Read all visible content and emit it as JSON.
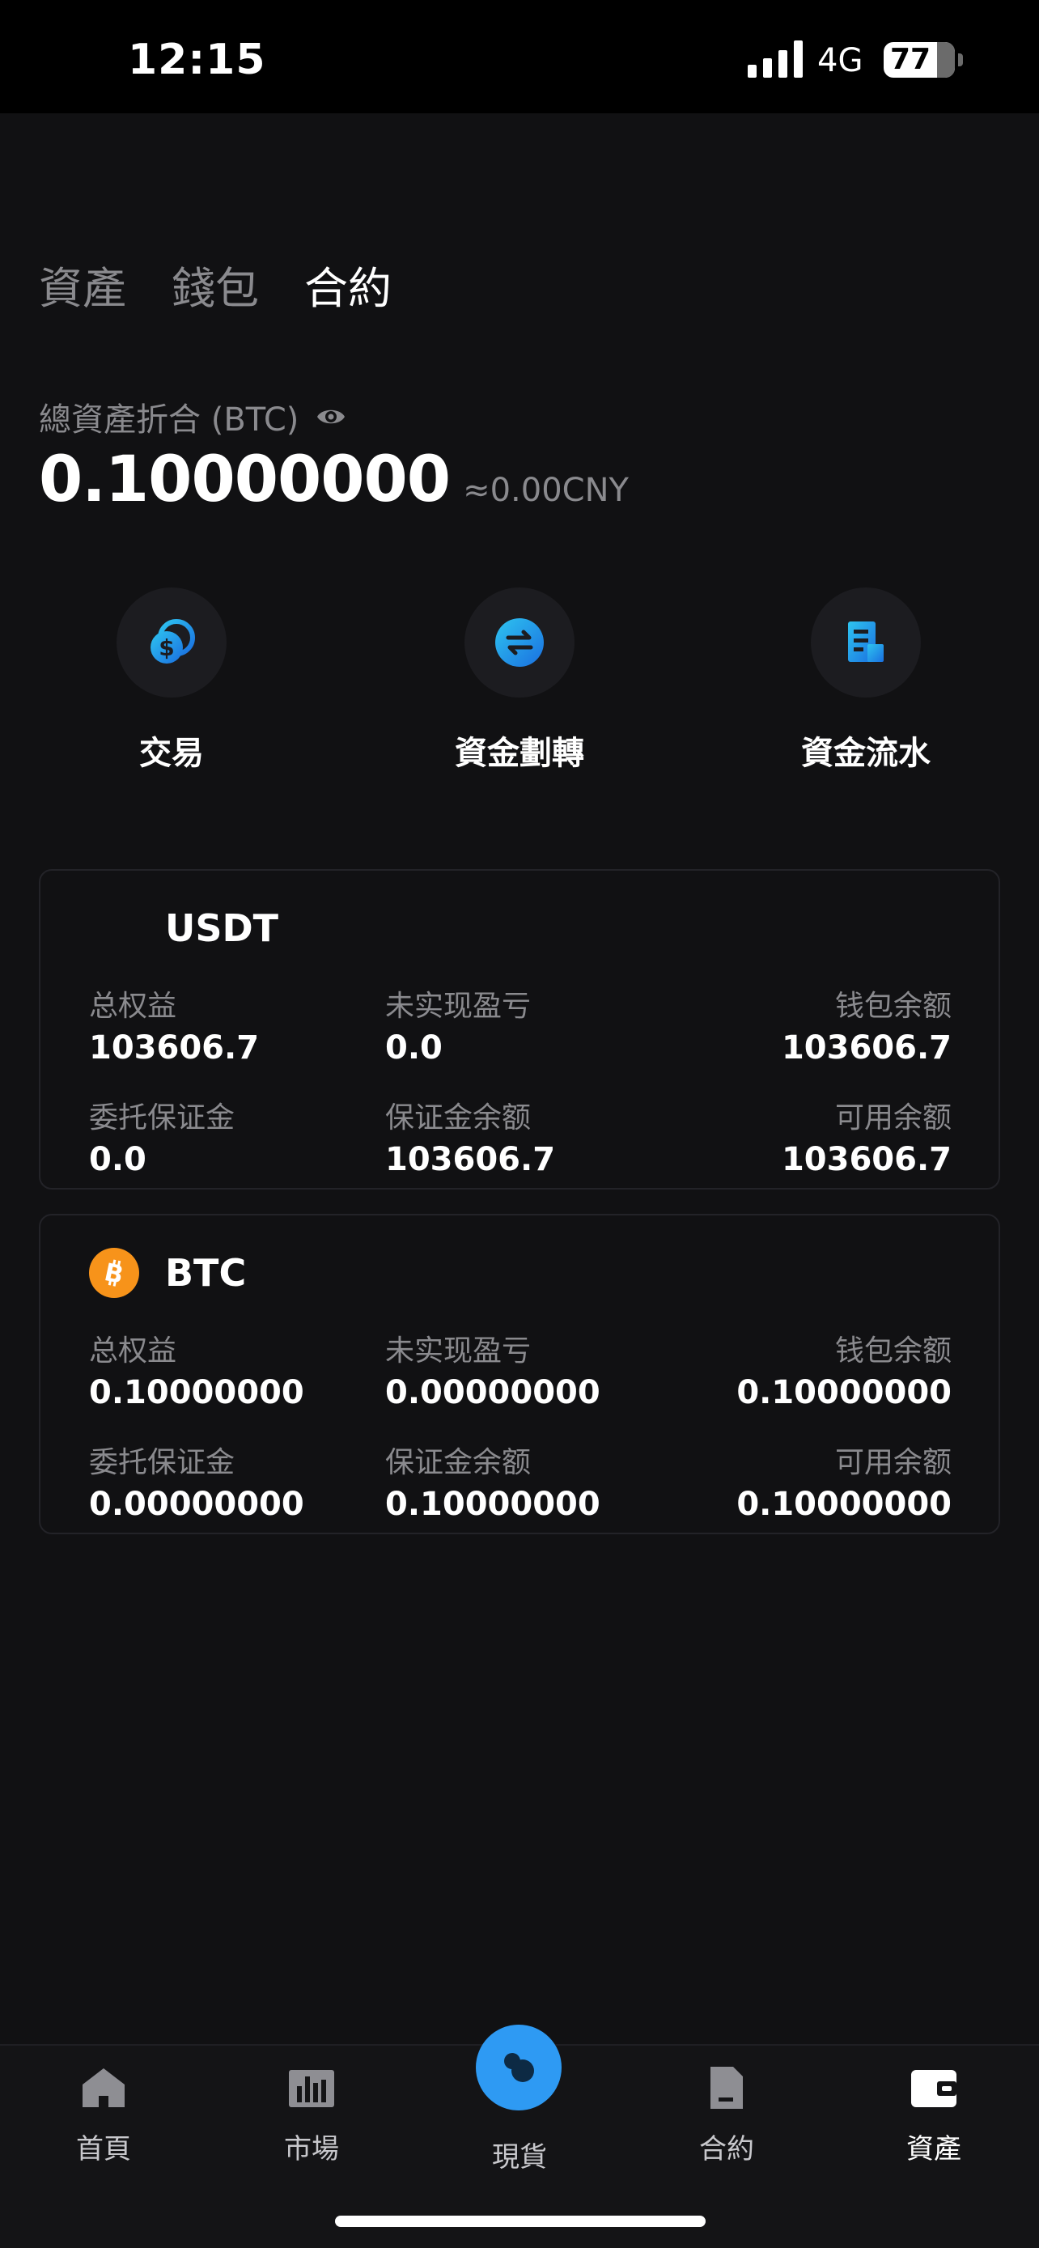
{
  "status_bar": {
    "time": "12:15",
    "network": "4G",
    "battery": "77"
  },
  "tabs": [
    {
      "label": "資產",
      "active": false
    },
    {
      "label": "錢包",
      "active": false
    },
    {
      "label": "合約",
      "active": true
    }
  ],
  "total": {
    "label": "總資產折合 (BTC)",
    "value": "0.10000000",
    "cny": "≈0.00CNY"
  },
  "actions": [
    {
      "label": "交易",
      "icon": "coin-swap-icon"
    },
    {
      "label": "資金劃轉",
      "icon": "transfer-icon"
    },
    {
      "label": "資金流水",
      "icon": "ledger-icon"
    }
  ],
  "accounts": [
    {
      "coin": "USDT",
      "icon": "",
      "total_equity_label": "总权益",
      "total_equity": "103606.7",
      "unrealized_pnl_label": "未实现盈亏",
      "unrealized_pnl": "0.0",
      "wallet_balance_label": "钱包余额",
      "wallet_balance": "103606.7",
      "order_margin_label": "委托保证金",
      "order_margin": "0.0",
      "margin_balance_label": "保证金余额",
      "margin_balance": "103606.7",
      "available_label": "可用余额",
      "available": "103606.7"
    },
    {
      "coin": "BTC",
      "icon": "bitcoin-icon",
      "total_equity_label": "总权益",
      "total_equity": "0.10000000",
      "unrealized_pnl_label": "未实现盈亏",
      "unrealized_pnl": "0.00000000",
      "wallet_balance_label": "钱包余额",
      "wallet_balance": "0.10000000",
      "order_margin_label": "委托保证金",
      "order_margin": "0.00000000",
      "margin_balance_label": "保证金余额",
      "margin_balance": "0.10000000",
      "available_label": "可用余额",
      "available": "0.10000000"
    }
  ],
  "bottom_nav": [
    {
      "label": "首頁",
      "icon": "home-icon"
    },
    {
      "label": "市場",
      "icon": "market-chart-icon"
    },
    {
      "label": "現貨",
      "icon": "spot-icon"
    },
    {
      "label": "合約",
      "icon": "contract-icon"
    },
    {
      "label": "資產",
      "icon": "wallet-icon",
      "active": true
    }
  ],
  "colors": {
    "accent": "#2e9af3",
    "btc_orange": "#f7931a",
    "background": "#111113",
    "muted_text": "#8a8a8e"
  }
}
